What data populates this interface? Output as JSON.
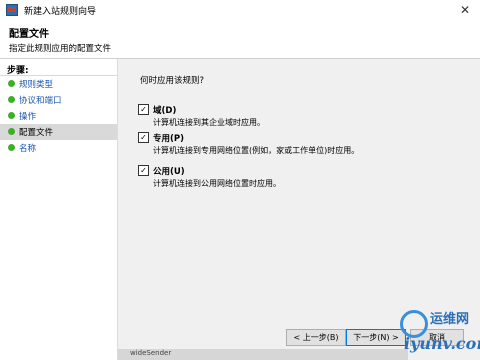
{
  "window": {
    "title": "新建入站规则向导",
    "close_glyph": "✕"
  },
  "header": {
    "title": "配置文件",
    "subtitle": "指定此规则应用的配置文件"
  },
  "sidebar": {
    "title": "步骤:",
    "items": [
      {
        "label": "规则类型"
      },
      {
        "label": "协议和端口"
      },
      {
        "label": "操作"
      },
      {
        "label": "配置文件"
      },
      {
        "label": "名称"
      }
    ],
    "selected_index": 3
  },
  "content": {
    "question": "何时应用该规则?",
    "options": [
      {
        "label": "域(D)",
        "description": "计算机连接到其企业域时应用。",
        "checked": true
      },
      {
        "label": "专用(P)",
        "description": "计算机连接到专用网络位置(例如，家或工作单位)时应用。",
        "checked": true
      },
      {
        "label": "公用(U)",
        "description": "计算机连接到公用网络位置时应用。",
        "checked": true
      }
    ],
    "check_glyph": "✓"
  },
  "buttons": {
    "back": "< 上一步(B)",
    "next": "下一步(N) >",
    "cancel": "取消"
  },
  "watermark": {
    "line1": "运维网",
    "line2": "iyunv.com"
  },
  "background_window": {
    "text": "wideSender"
  },
  "colors": {
    "accent": "#0078d7",
    "link": "#1a56b3",
    "step_dot": "#3fae2a",
    "selected_bg": "#d9d9d9"
  }
}
